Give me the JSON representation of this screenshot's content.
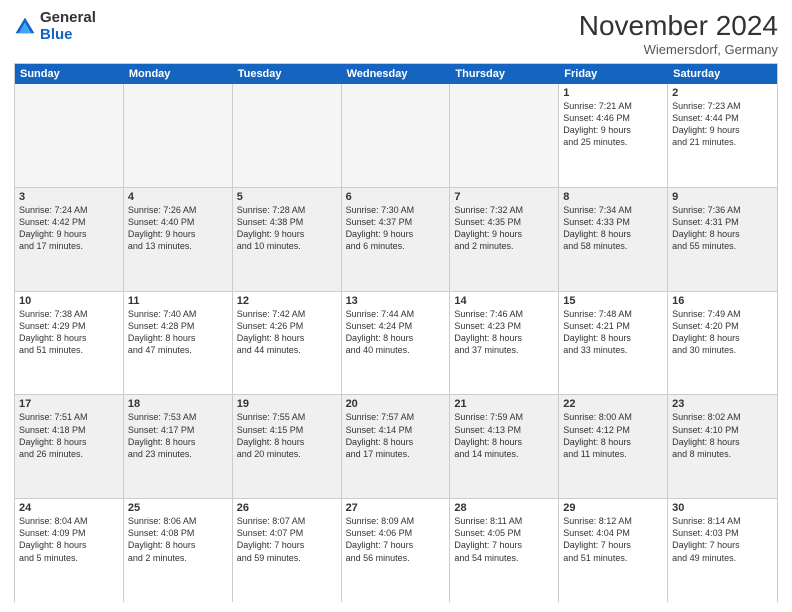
{
  "logo": {
    "general": "General",
    "blue": "Blue"
  },
  "title": "November 2024",
  "location": "Wiemersdorf, Germany",
  "weekdays": [
    "Sunday",
    "Monday",
    "Tuesday",
    "Wednesday",
    "Thursday",
    "Friday",
    "Saturday"
  ],
  "weeks": [
    [
      {
        "day": "",
        "info": "",
        "empty": true
      },
      {
        "day": "",
        "info": "",
        "empty": true
      },
      {
        "day": "",
        "info": "",
        "empty": true
      },
      {
        "day": "",
        "info": "",
        "empty": true
      },
      {
        "day": "",
        "info": "",
        "empty": true
      },
      {
        "day": "1",
        "info": "Sunrise: 7:21 AM\nSunset: 4:46 PM\nDaylight: 9 hours\nand 25 minutes."
      },
      {
        "day": "2",
        "info": "Sunrise: 7:23 AM\nSunset: 4:44 PM\nDaylight: 9 hours\nand 21 minutes."
      }
    ],
    [
      {
        "day": "3",
        "info": "Sunrise: 7:24 AM\nSunset: 4:42 PM\nDaylight: 9 hours\nand 17 minutes."
      },
      {
        "day": "4",
        "info": "Sunrise: 7:26 AM\nSunset: 4:40 PM\nDaylight: 9 hours\nand 13 minutes."
      },
      {
        "day": "5",
        "info": "Sunrise: 7:28 AM\nSunset: 4:38 PM\nDaylight: 9 hours\nand 10 minutes."
      },
      {
        "day": "6",
        "info": "Sunrise: 7:30 AM\nSunset: 4:37 PM\nDaylight: 9 hours\nand 6 minutes."
      },
      {
        "day": "7",
        "info": "Sunrise: 7:32 AM\nSunset: 4:35 PM\nDaylight: 9 hours\nand 2 minutes."
      },
      {
        "day": "8",
        "info": "Sunrise: 7:34 AM\nSunset: 4:33 PM\nDaylight: 8 hours\nand 58 minutes."
      },
      {
        "day": "9",
        "info": "Sunrise: 7:36 AM\nSunset: 4:31 PM\nDaylight: 8 hours\nand 55 minutes."
      }
    ],
    [
      {
        "day": "10",
        "info": "Sunrise: 7:38 AM\nSunset: 4:29 PM\nDaylight: 8 hours\nand 51 minutes."
      },
      {
        "day": "11",
        "info": "Sunrise: 7:40 AM\nSunset: 4:28 PM\nDaylight: 8 hours\nand 47 minutes."
      },
      {
        "day": "12",
        "info": "Sunrise: 7:42 AM\nSunset: 4:26 PM\nDaylight: 8 hours\nand 44 minutes."
      },
      {
        "day": "13",
        "info": "Sunrise: 7:44 AM\nSunset: 4:24 PM\nDaylight: 8 hours\nand 40 minutes."
      },
      {
        "day": "14",
        "info": "Sunrise: 7:46 AM\nSunset: 4:23 PM\nDaylight: 8 hours\nand 37 minutes."
      },
      {
        "day": "15",
        "info": "Sunrise: 7:48 AM\nSunset: 4:21 PM\nDaylight: 8 hours\nand 33 minutes."
      },
      {
        "day": "16",
        "info": "Sunrise: 7:49 AM\nSunset: 4:20 PM\nDaylight: 8 hours\nand 30 minutes."
      }
    ],
    [
      {
        "day": "17",
        "info": "Sunrise: 7:51 AM\nSunset: 4:18 PM\nDaylight: 8 hours\nand 26 minutes."
      },
      {
        "day": "18",
        "info": "Sunrise: 7:53 AM\nSunset: 4:17 PM\nDaylight: 8 hours\nand 23 minutes."
      },
      {
        "day": "19",
        "info": "Sunrise: 7:55 AM\nSunset: 4:15 PM\nDaylight: 8 hours\nand 20 minutes."
      },
      {
        "day": "20",
        "info": "Sunrise: 7:57 AM\nSunset: 4:14 PM\nDaylight: 8 hours\nand 17 minutes."
      },
      {
        "day": "21",
        "info": "Sunrise: 7:59 AM\nSunset: 4:13 PM\nDaylight: 8 hours\nand 14 minutes."
      },
      {
        "day": "22",
        "info": "Sunrise: 8:00 AM\nSunset: 4:12 PM\nDaylight: 8 hours\nand 11 minutes."
      },
      {
        "day": "23",
        "info": "Sunrise: 8:02 AM\nSunset: 4:10 PM\nDaylight: 8 hours\nand 8 minutes."
      }
    ],
    [
      {
        "day": "24",
        "info": "Sunrise: 8:04 AM\nSunset: 4:09 PM\nDaylight: 8 hours\nand 5 minutes."
      },
      {
        "day": "25",
        "info": "Sunrise: 8:06 AM\nSunset: 4:08 PM\nDaylight: 8 hours\nand 2 minutes."
      },
      {
        "day": "26",
        "info": "Sunrise: 8:07 AM\nSunset: 4:07 PM\nDaylight: 7 hours\nand 59 minutes."
      },
      {
        "day": "27",
        "info": "Sunrise: 8:09 AM\nSunset: 4:06 PM\nDaylight: 7 hours\nand 56 minutes."
      },
      {
        "day": "28",
        "info": "Sunrise: 8:11 AM\nSunset: 4:05 PM\nDaylight: 7 hours\nand 54 minutes."
      },
      {
        "day": "29",
        "info": "Sunrise: 8:12 AM\nSunset: 4:04 PM\nDaylight: 7 hours\nand 51 minutes."
      },
      {
        "day": "30",
        "info": "Sunrise: 8:14 AM\nSunset: 4:03 PM\nDaylight: 7 hours\nand 49 minutes."
      }
    ]
  ]
}
